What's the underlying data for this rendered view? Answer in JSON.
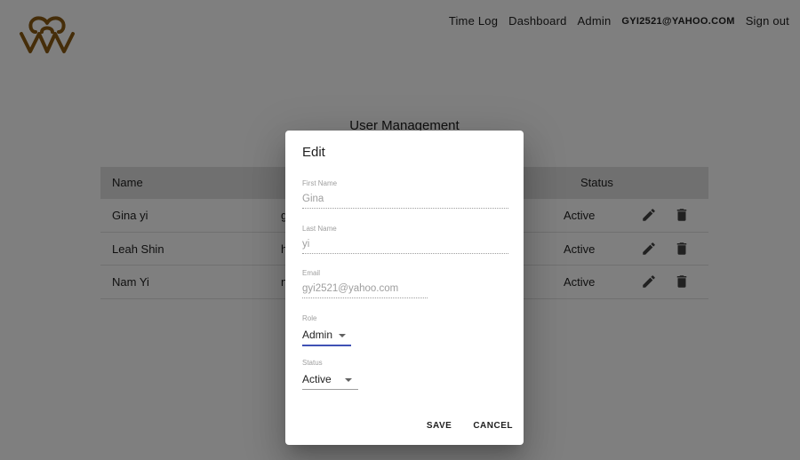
{
  "header": {
    "logo_color": "#8B5A12",
    "nav": {
      "time_log": "Time Log",
      "dashboard": "Dashboard",
      "admin": "Admin",
      "user_email": "GYI2521@YAHOO.COM",
      "sign_out": "Sign out"
    }
  },
  "main": {
    "title": "User Management",
    "table": {
      "headers": {
        "name": "Name",
        "status": "Status"
      },
      "rows": [
        {
          "name": "Gina yi",
          "email": "g",
          "status": "Active"
        },
        {
          "name": "Leah Shin",
          "email": "h",
          "status": "Active"
        },
        {
          "name": "Nam Yi",
          "email": "n",
          "status": "Active"
        }
      ]
    }
  },
  "dialog": {
    "title": "Edit",
    "fields": {
      "first_name": {
        "label": "First Name",
        "value": "Gina"
      },
      "last_name": {
        "label": "Last Name",
        "value": "yi"
      },
      "email": {
        "label": "Email",
        "value": "gyi2521@yahoo.com"
      },
      "role": {
        "label": "Role",
        "value": "Admin"
      },
      "status": {
        "label": "Status",
        "value": "Active"
      }
    },
    "actions": {
      "save": "SAVE",
      "cancel": "CANCEL"
    }
  },
  "colors": {
    "overlay": "rgba(0,0,0,0.5)",
    "accent": "#3f51b5"
  }
}
